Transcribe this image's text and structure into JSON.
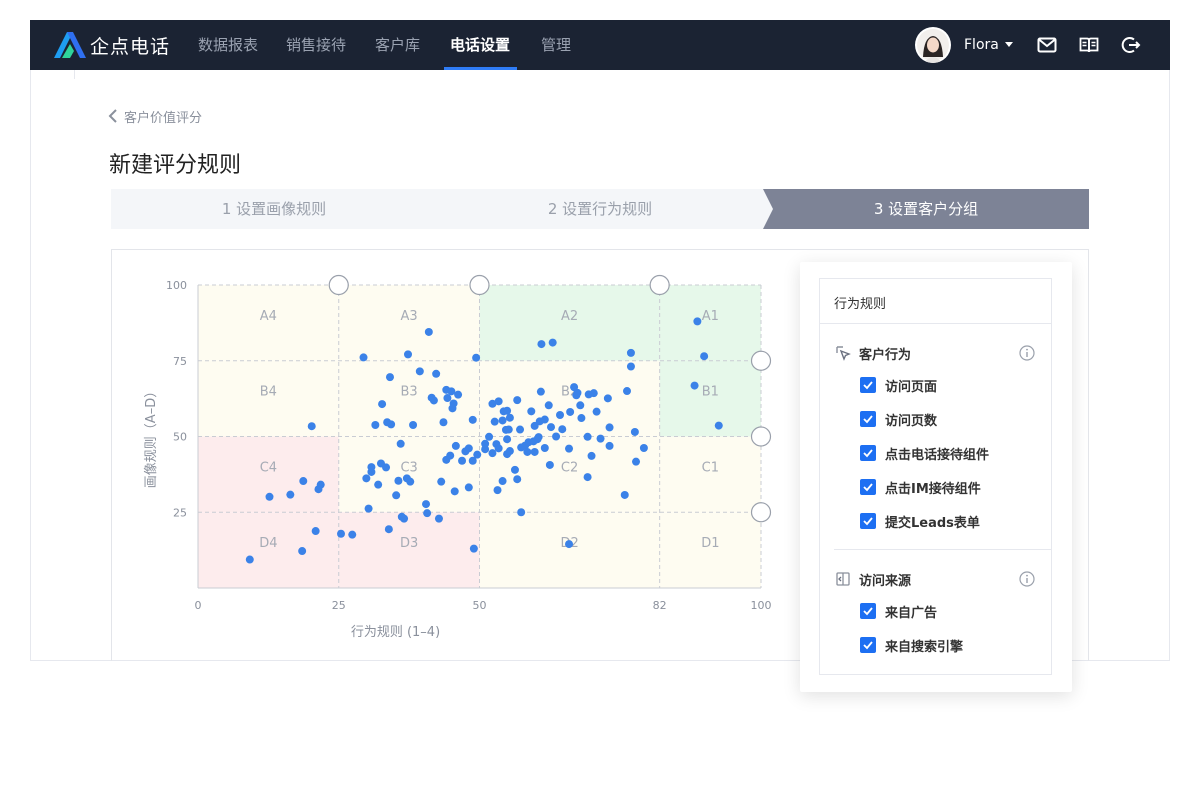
{
  "nav": {
    "brand": "企点电话",
    "items": [
      {
        "label": "数据报表",
        "active": false
      },
      {
        "label": "销售接待",
        "active": false
      },
      {
        "label": "客户库",
        "active": false
      },
      {
        "label": "电话设置",
        "active": true
      },
      {
        "label": "管理",
        "active": false
      }
    ],
    "user_name": "Flora",
    "icons": [
      "mail-icon",
      "book-icon",
      "logout-icon"
    ]
  },
  "breadcrumb": {
    "back_label": "客户价值评分"
  },
  "page_title": "新建评分规则",
  "steps": [
    {
      "label": "1 设置画像规则",
      "active": false
    },
    {
      "label": "2 设置行为规则",
      "active": false
    },
    {
      "label": "3 设置客户分组",
      "active": true
    }
  ],
  "chart_data": {
    "type": "scatter",
    "xlabel": "行为规则 (1–4)",
    "ylabel": "画像规则（A–D）",
    "xlim": [
      0,
      100
    ],
    "ylim": [
      0,
      100
    ],
    "x_ticks": [
      0,
      25,
      50,
      82,
      100
    ],
    "y_ticks": [
      25,
      50,
      75,
      100
    ],
    "x_breaks": [
      25,
      50,
      82
    ],
    "y_breaks": [
      25,
      50,
      75
    ],
    "grid": true,
    "regions": [
      {
        "label": "A4",
        "x": [
          0,
          25
        ],
        "y": [
          75,
          100
        ],
        "color": "#fefcf1"
      },
      {
        "label": "A3",
        "x": [
          25,
          50
        ],
        "y": [
          75,
          100
        ],
        "color": "#fefcf1"
      },
      {
        "label": "A2",
        "x": [
          50,
          82
        ],
        "y": [
          75,
          100
        ],
        "color": "#e6f8ea"
      },
      {
        "label": "A1",
        "x": [
          82,
          100
        ],
        "y": [
          75,
          100
        ],
        "color": "#e6f8ea"
      },
      {
        "label": "B4",
        "x": [
          0,
          25
        ],
        "y": [
          50,
          75
        ],
        "color": "#fefcf1"
      },
      {
        "label": "B3",
        "x": [
          25,
          50
        ],
        "y": [
          50,
          75
        ],
        "color": "#fefcf1"
      },
      {
        "label": "B2",
        "x": [
          50,
          82
        ],
        "y": [
          50,
          75
        ],
        "color": "#fefcf1"
      },
      {
        "label": "B1",
        "x": [
          82,
          100
        ],
        "y": [
          50,
          75
        ],
        "color": "#e6f8ea"
      },
      {
        "label": "C4",
        "x": [
          0,
          25
        ],
        "y": [
          25,
          50
        ],
        "color": "#fdeced"
      },
      {
        "label": "C3",
        "x": [
          25,
          50
        ],
        "y": [
          25,
          50
        ],
        "color": "#fefcf1"
      },
      {
        "label": "C2",
        "x": [
          50,
          82
        ],
        "y": [
          25,
          50
        ],
        "color": "#fefcf1"
      },
      {
        "label": "C1",
        "x": [
          82,
          100
        ],
        "y": [
          25,
          50
        ],
        "color": "#fefcf1"
      },
      {
        "label": "D4",
        "x": [
          0,
          25
        ],
        "y": [
          0,
          25
        ],
        "color": "#fdeced"
      },
      {
        "label": "D3",
        "x": [
          25,
          50
        ],
        "y": [
          0,
          25
        ],
        "color": "#fdeced"
      },
      {
        "label": "D2",
        "x": [
          50,
          82
        ],
        "y": [
          0,
          25
        ],
        "color": "#fefcf1"
      },
      {
        "label": "D1",
        "x": [
          82,
          100
        ],
        "y": [
          0,
          25
        ],
        "color": "#fefcf1"
      }
    ],
    "point_color": "#3b82e8",
    "points": [
      [
        9.2,
        9.4
      ],
      [
        12.7,
        30.1
      ],
      [
        16.4,
        30.8
      ],
      [
        18.5,
        12.2
      ],
      [
        18.7,
        35.3
      ],
      [
        20.2,
        53.4
      ],
      [
        20.9,
        18.8
      ],
      [
        21.4,
        32.6
      ],
      [
        21.8,
        34.1
      ],
      [
        25.4,
        17.9
      ],
      [
        27.4,
        17.6
      ],
      [
        29.4,
        76.1
      ],
      [
        29.9,
        36.2
      ],
      [
        30.3,
        26.2
      ],
      [
        30.8,
        38.3
      ],
      [
        30.8,
        39.9
      ],
      [
        31.5,
        53.8
      ],
      [
        32.0,
        34.1
      ],
      [
        32.5,
        41.1
      ],
      [
        32.7,
        60.7
      ],
      [
        33.4,
        39.8
      ],
      [
        33.6,
        54.7
      ],
      [
        34.1,
        69.6
      ],
      [
        34.3,
        54.0
      ],
      [
        33.9,
        19.4
      ],
      [
        35.2,
        30.6
      ],
      [
        35.6,
        35.4
      ],
      [
        36.0,
        47.6
      ],
      [
        36.2,
        23.5
      ],
      [
        36.6,
        22.9
      ],
      [
        37.1,
        36.2
      ],
      [
        37.3,
        77.1
      ],
      [
        37.7,
        35.1
      ],
      [
        38.2,
        53.8
      ],
      [
        39.4,
        71.5
      ],
      [
        40.5,
        27.7
      ],
      [
        40.7,
        24.7
      ],
      [
        41.0,
        84.5
      ],
      [
        41.5,
        62.8
      ],
      [
        41.9,
        61.9
      ],
      [
        42.3,
        70.7
      ],
      [
        42.8,
        22.9
      ],
      [
        43.2,
        35.1
      ],
      [
        43.6,
        54.7
      ],
      [
        44.1,
        65.4
      ],
      [
        44.1,
        42.3
      ],
      [
        44.3,
        62.7
      ],
      [
        44.8,
        43.7
      ],
      [
        45.0,
        64.9
      ],
      [
        45.2,
        59.3
      ],
      [
        45.4,
        60.9
      ],
      [
        45.6,
        31.9
      ],
      [
        45.8,
        46.9
      ],
      [
        46.2,
        63.8
      ],
      [
        46.9,
        42.0
      ],
      [
        47.5,
        45.1
      ],
      [
        48.1,
        33.2
      ],
      [
        48.1,
        46.1
      ],
      [
        48.8,
        42.0
      ],
      [
        48.8,
        55.5
      ],
      [
        49.0,
        13.0
      ],
      [
        49.4,
        76.0
      ],
      [
        49.6,
        44.0
      ],
      [
        51.0,
        45.8
      ],
      [
        51.0,
        47.6
      ],
      [
        51.7,
        49.9
      ],
      [
        52.3,
        60.8
      ],
      [
        52.3,
        44.5
      ],
      [
        52.7,
        54.9
      ],
      [
        53.0,
        47.5
      ],
      [
        53.2,
        32.3
      ],
      [
        53.4,
        46.1
      ],
      [
        53.4,
        61.6
      ],
      [
        54.1,
        55.3
      ],
      [
        54.1,
        35.3
      ],
      [
        54.3,
        58.3
      ],
      [
        54.7,
        52.2
      ],
      [
        54.9,
        49.1
      ],
      [
        54.9,
        44.2
      ],
      [
        54.9,
        58.5
      ],
      [
        55.2,
        52.3
      ],
      [
        55.4,
        45.2
      ],
      [
        55.4,
        56.2
      ],
      [
        56.3,
        39.0
      ],
      [
        56.7,
        62.0
      ],
      [
        56.7,
        35.9
      ],
      [
        57.2,
        52.3
      ],
      [
        57.4,
        25.0
      ],
      [
        57.4,
        46.4
      ],
      [
        58.1,
        47.0
      ],
      [
        58.5,
        44.9
      ],
      [
        58.7,
        48.1
      ],
      [
        59.2,
        58.3
      ],
      [
        59.6,
        48.4
      ],
      [
        59.8,
        53.5
      ],
      [
        59.8,
        44.9
      ],
      [
        60.3,
        49.1
      ],
      [
        60.5,
        49.8
      ],
      [
        60.7,
        55.0
      ],
      [
        60.9,
        64.8
      ],
      [
        61.0,
        80.5
      ],
      [
        61.6,
        55.6
      ],
      [
        61.6,
        46.2
      ],
      [
        62.3,
        60.3
      ],
      [
        62.5,
        40.6
      ],
      [
        62.7,
        53.1
      ],
      [
        63.0,
        81.0
      ],
      [
        63.6,
        50.0
      ],
      [
        64.3,
        57.1
      ],
      [
        64.7,
        52.4
      ],
      [
        65.9,
        46.0
      ],
      [
        65.9,
        14.5
      ],
      [
        66.1,
        58.1
      ],
      [
        66.8,
        66.3
      ],
      [
        67.2,
        63.6
      ],
      [
        67.4,
        64.4
      ],
      [
        67.9,
        60.3
      ],
      [
        68.1,
        56.1
      ],
      [
        69.2,
        36.6
      ],
      [
        69.2,
        49.9
      ],
      [
        69.4,
        63.9
      ],
      [
        69.9,
        43.6
      ],
      [
        70.3,
        64.3
      ],
      [
        70.8,
        58.2
      ],
      [
        71.5,
        49.3
      ],
      [
        72.8,
        62.6
      ],
      [
        73.1,
        53.0
      ],
      [
        73.1,
        46.9
      ],
      [
        75.8,
        30.7
      ],
      [
        76.2,
        65.0
      ],
      [
        76.9,
        77.6
      ],
      [
        76.9,
        73.1
      ],
      [
        77.6,
        51.5
      ],
      [
        77.8,
        41.7
      ],
      [
        79.2,
        46.2
      ],
      [
        88.2,
        66.8
      ],
      [
        88.7,
        88.0
      ],
      [
        89.9,
        76.5
      ],
      [
        92.5,
        53.6
      ]
    ],
    "handles": [
      {
        "x": 25,
        "y": 100
      },
      {
        "x": 50,
        "y": 100
      },
      {
        "x": 82,
        "y": 100
      },
      {
        "x": 100,
        "y": 75
      },
      {
        "x": 100,
        "y": 50
      },
      {
        "x": 100,
        "y": 25
      }
    ]
  },
  "panel": {
    "title": "行为规则",
    "groups": [
      {
        "label": "客户行为",
        "icon": "cursor-icon",
        "items": [
          {
            "label": "访问页面",
            "checked": true
          },
          {
            "label": "访问页数",
            "checked": true
          },
          {
            "label": "点击电话接待组件",
            "checked": true
          },
          {
            "label": "点击IM接待组件",
            "checked": true
          },
          {
            "label": "提交Leads表单",
            "checked": true
          }
        ]
      },
      {
        "label": "访问来源",
        "icon": "source-icon",
        "items": [
          {
            "label": "来自广告",
            "checked": true
          },
          {
            "label": "来自搜索引擎",
            "checked": true
          }
        ]
      }
    ]
  }
}
